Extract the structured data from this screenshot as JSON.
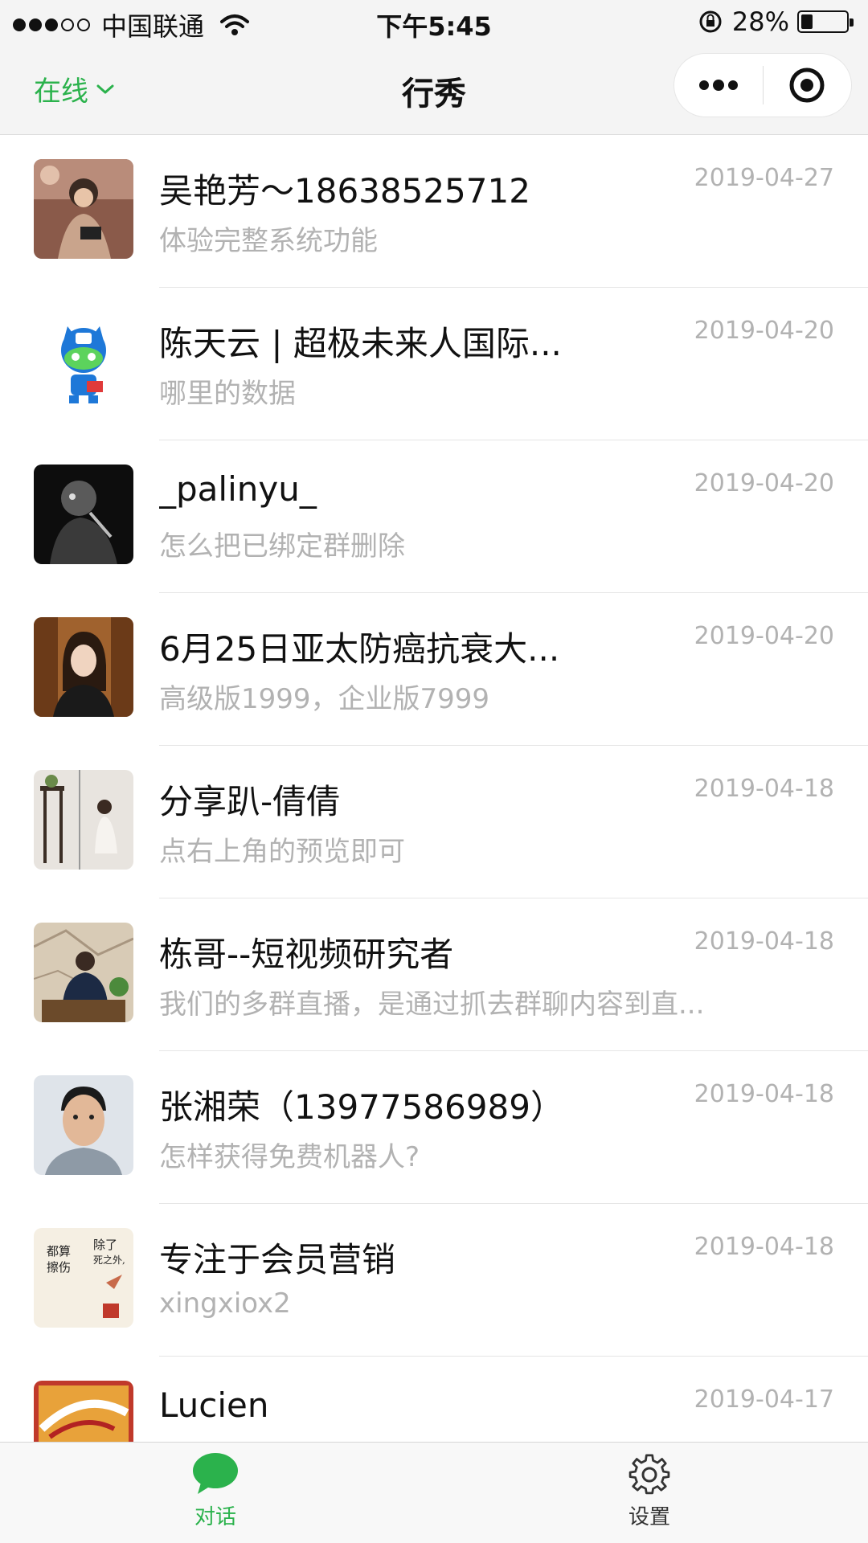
{
  "status_bar": {
    "carrier": "中国联通",
    "time": "下午5:45",
    "battery": "28%",
    "signal_strength": 3,
    "signal_max": 5
  },
  "nav": {
    "status_label": "在线",
    "title": "行秀"
  },
  "conversations": [
    {
      "name": "吴艳芳～18638525712",
      "preview": "体验完整系统功能",
      "date": "2019-04-27"
    },
    {
      "name": "陈天云 | 超极未来人国际...",
      "preview": "哪里的数据",
      "date": "2019-04-20"
    },
    {
      "name": "_palinyu_",
      "preview": "怎么把已绑定群删除",
      "date": "2019-04-20"
    },
    {
      "name": "6月25日亚太防癌抗衰大...",
      "preview": "高级版1999，企业版7999",
      "date": "2019-04-20"
    },
    {
      "name": "分享趴-倩倩",
      "preview": "点右上角的预览即可",
      "date": "2019-04-18"
    },
    {
      "name": "栋哥--短视频研究者",
      "preview": "我们的多群直播，是通过抓去群聊内容到直...",
      "date": "2019-04-18"
    },
    {
      "name": "张湘荣（13977586989）",
      "preview": "怎样获得免费机器人?",
      "date": "2019-04-18"
    },
    {
      "name": "专注于会员营销",
      "preview": "xingxiox2",
      "date": "2019-04-18"
    },
    {
      "name": "Lucien",
      "preview": "",
      "date": "2019-04-17"
    }
  ],
  "avatar_art": {
    "calligraphy_lines": [
      "除了",
      "死之外,",
      "都算",
      "擦伤"
    ]
  },
  "tabs": [
    {
      "label": "对话",
      "icon": "chat-bubble-icon",
      "active": true
    },
    {
      "label": "设置",
      "icon": "gear-icon",
      "active": false
    }
  ],
  "colors": {
    "accent": "#2bb24c",
    "secondary_text": "#b2b2b2",
    "bar_background": "#f4f4f4"
  }
}
